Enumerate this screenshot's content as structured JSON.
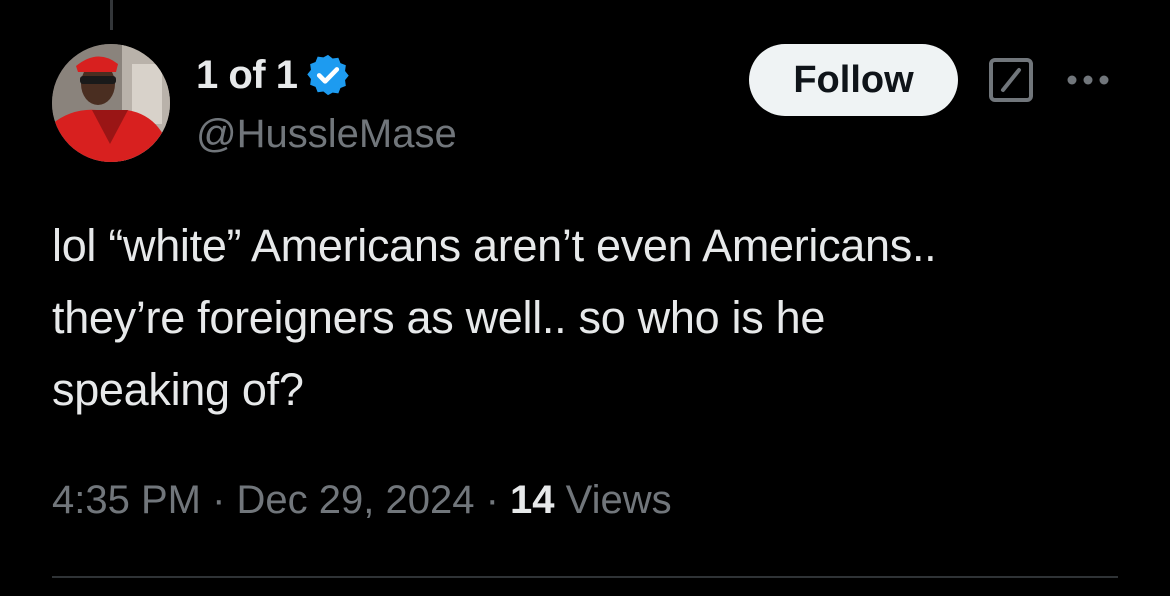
{
  "author": {
    "display_name": "1 of 1",
    "handle": "@HussleMase",
    "verified": true,
    "avatar_icon": "avatar-photo"
  },
  "actions": {
    "follow_label": "Follow",
    "grok_icon": "grok-icon",
    "more_icon": "more-dots-icon"
  },
  "tweet": {
    "text": "lol “white” Americans aren’t even Americans..\nthey’re foreigners as well.. so who is he\nspeaking of?"
  },
  "meta": {
    "time": "4:35 PM",
    "separator": " · ",
    "date": "Dec 29, 2024",
    "views_count": "14",
    "views_label": " Views"
  },
  "colors": {
    "background": "#000000",
    "text_primary": "#e7e9ea",
    "text_secondary": "#71767b",
    "verified_blue": "#1d9bf0",
    "follow_bg": "#eff3f4"
  }
}
